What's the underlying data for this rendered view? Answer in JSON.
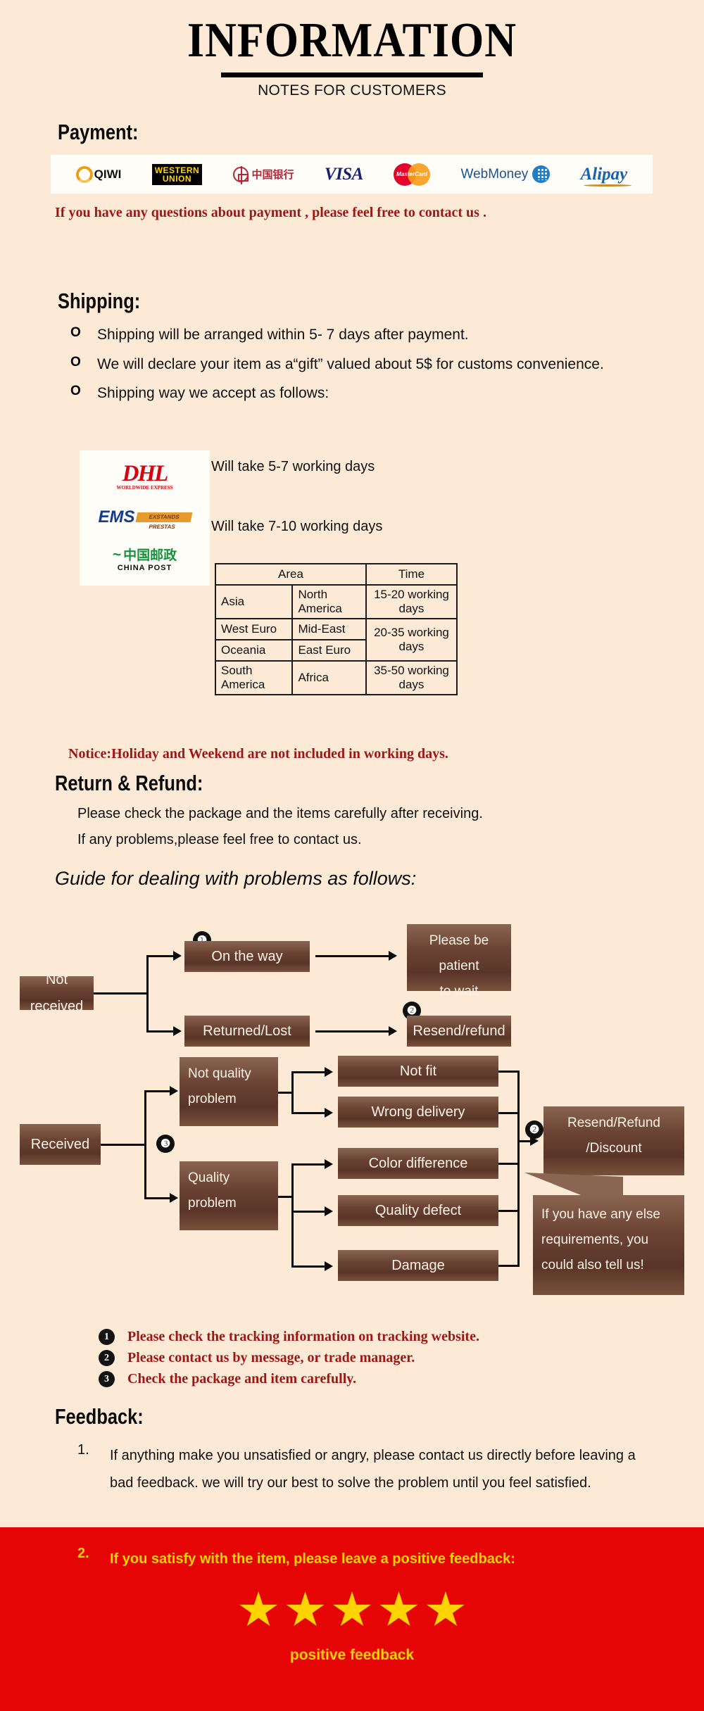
{
  "header": {
    "title": "INFORMATION",
    "subtitle": "NOTES FOR CUSTOMERS"
  },
  "payment": {
    "heading": "Payment:",
    "note": "If you have any questions about payment , please feel free to contact us .",
    "methods": [
      {
        "name": "QIWI",
        "label": "QIWI"
      },
      {
        "name": "western-union",
        "label_line1": "WESTERN",
        "label_line2": "UNION"
      },
      {
        "name": "bank-of-china",
        "label": "中国银行"
      },
      {
        "name": "visa",
        "label": "VISA"
      },
      {
        "name": "mastercard",
        "label": "MasterCard"
      },
      {
        "name": "webmoney",
        "label": "WebMoney"
      },
      {
        "name": "alipay",
        "label": "Alipay"
      }
    ]
  },
  "shipping": {
    "heading": "Shipping:",
    "bullets": [
      "Shipping will be arranged within  5- 7  days after payment.",
      "We will declare your item as a“gift” valued about 5$ for customs convenience.",
      "Shipping way we accept as follows:"
    ],
    "bullet_marker": "O",
    "carriers": [
      {
        "name": "dhl",
        "label": "DHL",
        "sub": "WORLDWIDE EXPRESS",
        "time": "Will take 5-7 working days"
      },
      {
        "name": "ems",
        "label": "EMS",
        "sub": "EXSTANDS PRESTAS",
        "time": "Will take 7-10 working days"
      },
      {
        "name": "china-post",
        "label": "中国邮政",
        "sub": "CHINA POST",
        "time": ""
      }
    ],
    "table": {
      "header_area": "Area",
      "header_time": "Time",
      "rows": [
        {
          "area_a": "Asia",
          "area_b": "North America",
          "time": "15-20 working days"
        },
        {
          "area_a": "West Euro",
          "area_b": "Mid-East",
          "time": "20-35 working days"
        },
        {
          "area_a": "Oceania",
          "area_b": "East Euro",
          "time": ""
        },
        {
          "area_a": "South America",
          "area_b": "Africa",
          "time": "35-50 working days"
        }
      ]
    },
    "notice": "Notice:Holiday and Weekend are not included in working days."
  },
  "return": {
    "heading": "Return & Refund:",
    "line1": "Please check the package and the items carefully after receiving.",
    "line2": "If any problems,please feel free to contact us.",
    "guide_title": "Guide for dealing with problems as follows:"
  },
  "flowchart": {
    "not_received": "Not received",
    "on_the_way": "On the way",
    "returned_lost": "Returned/Lost",
    "be_patient_l1": "Please be patient",
    "be_patient_l2": "to wait",
    "resend_refund": "Resend/refund",
    "received": "Received",
    "not_quality_l1": "Not quality",
    "not_quality_l2": "problem",
    "quality_l1": "Quality",
    "quality_l2": "problem",
    "not_fit": "Not fit",
    "wrong_delivery": "Wrong delivery",
    "color_difference": "Color difference",
    "quality_defect": "Quality defect",
    "damage": "Damage",
    "resend_refund_discount_l1": "Resend/Refund",
    "resend_refund_discount_l2": "/Discount",
    "callout_l1": "If you have any else",
    "callout_l2": "requirements, you",
    "callout_l3": "could also tell us!",
    "badge1": "❶",
    "badge2": "❷",
    "badge3": "❸"
  },
  "notes": [
    {
      "num": "❶",
      "text": "Please check the tracking information on tracking website."
    },
    {
      "num": "❷",
      "text": "Please contact us by message, or trade manager."
    },
    {
      "num": "❸",
      "text": "Check the package and item carefully."
    }
  ],
  "feedback": {
    "heading": "Feedback:",
    "item1_num": "1.",
    "item1_text": "If anything make you unsatisfied or angry, please contact us directly before leaving a bad feedback. we will try our best to solve the problem until  you feel satisfied.",
    "item2_num": "2.",
    "item2_text": "If you satisfy with the item, please leave a positive feedback:",
    "caption": "positive feedback",
    "star_count": 5
  },
  "colors": {
    "page_background": "#fdead6",
    "red_accent": "#9c1616",
    "footer_red": "#e60505",
    "star_yellow": "#ffd400",
    "box_brown": "#6b4334"
  }
}
